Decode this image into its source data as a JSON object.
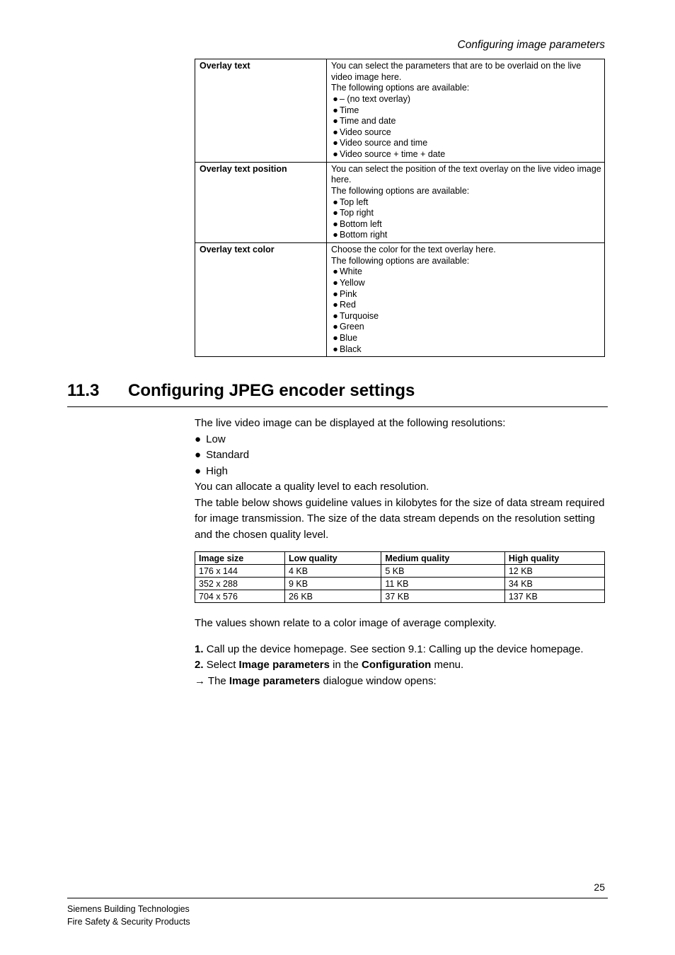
{
  "header": "Configuring image parameters",
  "table1": {
    "rows": [
      {
        "label": "Overlay text",
        "intro": "You can select the parameters that are to be overlaid on the live video image here.",
        "opts_label": "The following options are available:",
        "items": [
          "– (no text overlay)",
          "Time",
          "Time and date",
          "Video source",
          "Video source and time",
          "Video source + time + date"
        ]
      },
      {
        "label": "Overlay text position",
        "intro": "You can select the position of the text overlay on the live video image here.",
        "opts_label": "The following options are available:",
        "items": [
          "Top left",
          "Top right",
          "Bottom left",
          "Bottom right"
        ]
      },
      {
        "label": "Overlay text color",
        "intro": "Choose the color for the text overlay here.",
        "opts_label": "The following options are available:",
        "items": [
          "White",
          "Yellow",
          "Pink",
          "Red",
          "Turquoise",
          "Green",
          "Blue",
          "Black"
        ]
      }
    ]
  },
  "section": {
    "num": "11.3",
    "title": "Configuring JPEG encoder settings"
  },
  "body": {
    "p1": "The live video image can be displayed at the following resolutions:",
    "items": [
      "Low",
      "Standard",
      "High"
    ],
    "p2": "You can allocate a quality level to each resolution.",
    "p3": "The table below shows guideline values in kilobytes for the size of data stream required for image transmission. The size of the data stream depends on the resolution setting and the chosen quality level."
  },
  "sizes": {
    "headers": [
      "Image size",
      "Low quality",
      "Medium quality",
      "High quality"
    ],
    "rows": [
      [
        "176 x 144",
        "4 KB",
        "5 KB",
        "12 KB"
      ],
      [
        "352 x 288",
        "9 KB",
        "11 KB",
        "34 KB"
      ],
      [
        "704 x 576",
        "26 KB",
        "37 KB",
        "137 KB"
      ]
    ]
  },
  "after": {
    "p1": "The values shown relate to a color image of average complexity.",
    "s1": {
      "num": "1.",
      "text_a": "Call up the device homepage. See section 9.1: Calling up the device homepage."
    },
    "s2": {
      "num": "2.",
      "text_a": "Select ",
      "b1": "Image parameters",
      "text_b": " in the ",
      "b2": "Configuration",
      "text_c": " menu."
    },
    "s3": {
      "arrow": "→",
      "text_a": "The ",
      "b1": "Image parameters",
      "text_b": " dialogue window opens:"
    }
  },
  "footer": {
    "pagenum": "25",
    "line1": "Siemens Building Technologies",
    "line2": "Fire Safety & Security Products"
  }
}
